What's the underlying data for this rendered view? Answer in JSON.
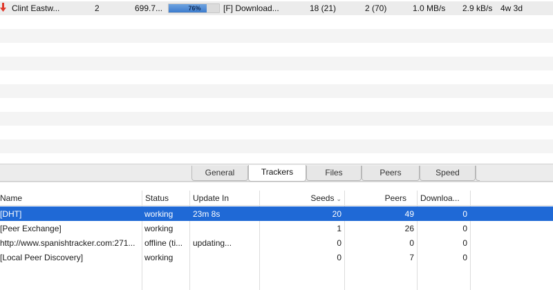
{
  "torrent": {
    "name": "Clint Eastw...",
    "count": "2",
    "size": "699.7...",
    "progress_label": "76%",
    "progress": 0.76,
    "status": "[F] Download...",
    "seeds": "18 (21)",
    "peers": "2 (70)",
    "down_speed": "1.0 MB/s",
    "up_speed": "2.9 kB/s",
    "eta": "4w 3d",
    "status_icon": "download-arrow-icon",
    "icon_color": "#e0392b"
  },
  "tabs": [
    {
      "label": "General"
    },
    {
      "label": "Trackers"
    },
    {
      "label": "Files"
    },
    {
      "label": "Peers"
    },
    {
      "label": "Speed"
    }
  ],
  "active_tab": "Trackers",
  "trackers": {
    "headers": [
      "Name",
      "Status",
      "Update In",
      "Seeds",
      "Peers",
      "Downloa..."
    ],
    "sort_icon": "chevron-down-icon",
    "rows": [
      {
        "name": "[DHT]",
        "status": "working",
        "update_in": "23m 8s",
        "seeds": "20",
        "peers": "49",
        "downloaded": "0",
        "selected": true
      },
      {
        "name": "[Peer Exchange]",
        "status": "working",
        "update_in": "",
        "seeds": "1",
        "peers": "26",
        "downloaded": "0",
        "selected": false
      },
      {
        "name": "http://www.spanishtracker.com:271...",
        "status": "offline (ti...",
        "update_in": "updating...",
        "seeds": "0",
        "peers": "0",
        "downloaded": "0",
        "selected": false
      },
      {
        "name": "[Local Peer Discovery]",
        "status": "working",
        "update_in": "",
        "seeds": "0",
        "peers": "7",
        "downloaded": "0",
        "selected": false
      }
    ]
  },
  "colors": {
    "selection": "#1f69d6",
    "progress": "#3c7bcd"
  }
}
